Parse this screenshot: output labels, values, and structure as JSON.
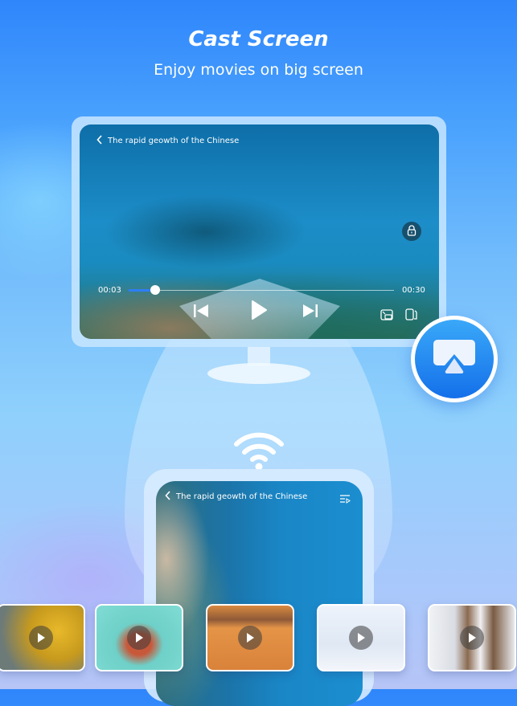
{
  "header": {
    "title": "Cast Screen",
    "subtitle": "Enjoy movies on big screen"
  },
  "tv_player": {
    "video_title": "The rapid geowth of the Chinese",
    "current_time": "00:03",
    "total_time": "00:30",
    "progress_fraction": 0.1,
    "icons": [
      "back-chevron-icon",
      "lock-icon",
      "previous-icon",
      "play-icon",
      "next-icon",
      "picture-in-picture-icon",
      "rotate-screen-icon"
    ]
  },
  "cast_button": {
    "icon": "airplay-cast-icon",
    "accent_color": "#1f86f1"
  },
  "connection": {
    "icon": "wifi-icon"
  },
  "phone_player": {
    "video_title": "The rapid geowth of the Chinese",
    "icons": [
      "back-chevron-icon",
      "playlist-icon"
    ]
  },
  "thumbnails": [
    {
      "subject": "autumn forest road",
      "icon": "play-icon"
    },
    {
      "subject": "river rafting",
      "icon": "play-icon"
    },
    {
      "subject": "desert camel rider",
      "icon": "play-icon"
    },
    {
      "subject": "musk oxen in snow",
      "icon": "play-icon"
    },
    {
      "subject": "sled dogs",
      "icon": "play-icon"
    }
  ]
}
